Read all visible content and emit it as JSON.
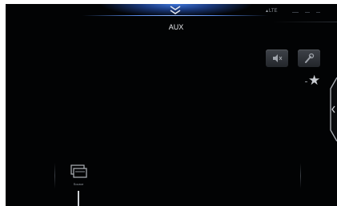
{
  "header": {
    "status_left": "",
    "source_title": "AUX",
    "signal_text": "LTE",
    "arrow_icon": "double-chevron-down-icon",
    "accent_color": "#3d73d6"
  },
  "side_controls": [
    {
      "name": "mute",
      "icon": "speaker-mute-icon"
    },
    {
      "name": "settings",
      "icon": "wrench-icon"
    }
  ],
  "favorite": {
    "icon": "star-icon",
    "prefix": "+"
  },
  "dock": {
    "items": [
      {
        "name": "source",
        "icon": "source-menu-icon",
        "label": "Source"
      }
    ]
  }
}
